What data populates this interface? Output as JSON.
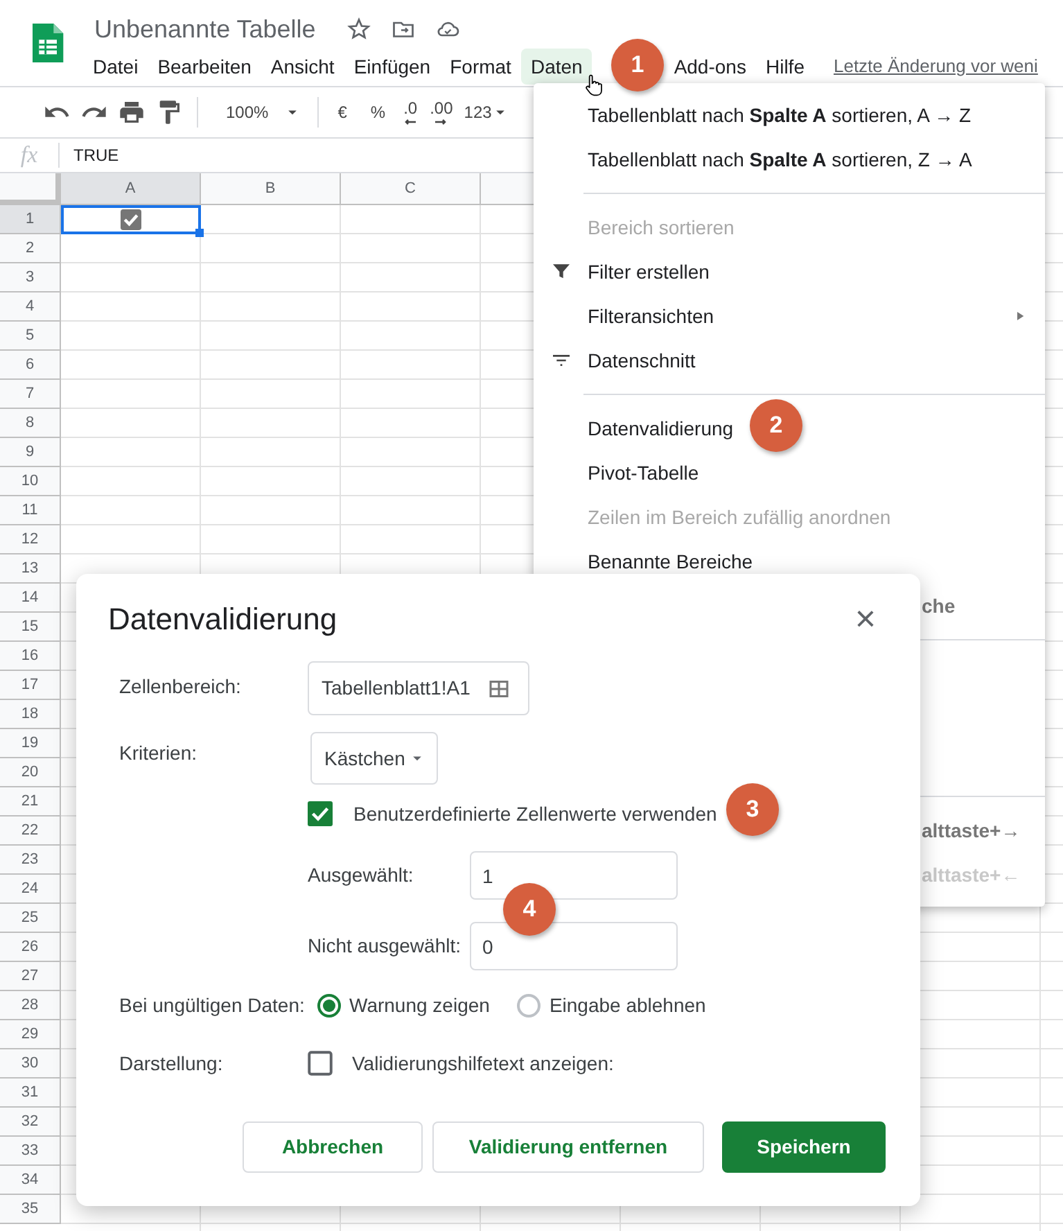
{
  "document": {
    "title": "Unbenannte Tabelle"
  },
  "menu_bar": [
    {
      "label": "Datei",
      "selected": false
    },
    {
      "label": "Bearbeiten",
      "selected": false
    },
    {
      "label": "Ansicht",
      "selected": false
    },
    {
      "label": "Einfügen",
      "selected": false
    },
    {
      "label": "Format",
      "selected": false
    },
    {
      "label": "Daten",
      "selected": true
    },
    {
      "label": "Add-ons",
      "selected": false
    },
    {
      "label": "Hilfe",
      "selected": false
    }
  ],
  "last_edit_link": "Letzte Änderung vor weni",
  "toolbar": {
    "zoom": "100%",
    "currency": "€",
    "percent": "%",
    "decrease_decimals": ".0",
    "increase_decimals": ".00",
    "number_format": "123"
  },
  "formula_bar": {
    "fx": "fx",
    "value": "TRUE"
  },
  "grid": {
    "columns": [
      {
        "label": "A",
        "selected": true
      },
      {
        "label": "B",
        "selected": false
      },
      {
        "label": "C",
        "selected": false
      }
    ],
    "rows": [
      {
        "label": "1",
        "selected": true
      },
      {
        "label": "2",
        "selected": false
      },
      {
        "label": "3",
        "selected": false
      },
      {
        "label": "4",
        "selected": false
      },
      {
        "label": "5",
        "selected": false
      },
      {
        "label": "6",
        "selected": false
      },
      {
        "label": "7",
        "selected": false
      },
      {
        "label": "8",
        "selected": false
      },
      {
        "label": "9",
        "selected": false
      },
      {
        "label": "10",
        "selected": false
      },
      {
        "label": "11",
        "selected": false
      },
      {
        "label": "12",
        "selected": false
      },
      {
        "label": "13",
        "selected": false
      },
      {
        "label": "14",
        "selected": false
      },
      {
        "label": "15",
        "selected": false
      },
      {
        "label": "16",
        "selected": false
      },
      {
        "label": "17",
        "selected": false
      },
      {
        "label": "18",
        "selected": false
      },
      {
        "label": "19",
        "selected": false
      },
      {
        "label": "20",
        "selected": false
      },
      {
        "label": "21",
        "selected": false
      },
      {
        "label": "22",
        "selected": false
      },
      {
        "label": "23",
        "selected": false
      },
      {
        "label": "24",
        "selected": false
      },
      {
        "label": "25",
        "selected": false
      },
      {
        "label": "26",
        "selected": false
      },
      {
        "label": "27",
        "selected": false
      },
      {
        "label": "28",
        "selected": false
      },
      {
        "label": "29",
        "selected": false
      },
      {
        "label": "30",
        "selected": false
      },
      {
        "label": "31",
        "selected": false
      },
      {
        "label": "32",
        "selected": false
      },
      {
        "label": "33",
        "selected": false
      },
      {
        "label": "34",
        "selected": false
      },
      {
        "label": "35",
        "selected": false
      }
    ],
    "cell_a1": {
      "kind": "checkbox",
      "checked": true,
      "selected": true
    }
  },
  "data_menu": [
    {
      "kind": "item",
      "label": "Tabellenblatt nach **Spalte A** sortieren, A → Z",
      "disabled": false
    },
    {
      "kind": "item",
      "label": "Tabellenblatt nach **Spalte A** sortieren, Z → A",
      "disabled": false
    },
    {
      "kind": "divider"
    },
    {
      "kind": "item",
      "label": "Bereich sortieren",
      "disabled": true
    },
    {
      "kind": "filter",
      "label": "Filter erstellen",
      "disabled": false
    },
    {
      "kind": "submenu",
      "label": "Filteransichten",
      "disabled": false
    },
    {
      "kind": "slicer",
      "label": "Datenschnitt",
      "disabled": false
    },
    {
      "kind": "divider"
    },
    {
      "kind": "item",
      "label": "Datenvalidierung",
      "disabled": false
    },
    {
      "kind": "item",
      "label": "Pivot-Tabelle",
      "disabled": false
    },
    {
      "kind": "item",
      "label": "Zeilen im Bereich zufällig anordnen",
      "disabled": true
    },
    {
      "kind": "item",
      "label": "Benannte Bereiche",
      "disabled": false
    },
    {
      "kind": "partial",
      "label": "che",
      "disabled": false
    },
    {
      "kind": "divider"
    },
    {
      "kind": "hidden"
    },
    {
      "kind": "hidden"
    },
    {
      "kind": "hidden"
    },
    {
      "kind": "divider"
    },
    {
      "kind": "partial",
      "label": "alttaste+→",
      "disabled": false
    },
    {
      "kind": "partial",
      "label": "alttaste+←",
      "disabled": true
    }
  ],
  "dialog": {
    "title": "Datenvalidierung",
    "close": "×",
    "cell_range": {
      "label": "Zellenbereich:",
      "value": "Tabellenblatt1!A1"
    },
    "criteria": {
      "label": "Kriterien:",
      "value": "Kästchen"
    },
    "custom_values": {
      "label": "Benutzerdefinierte Zellenwerte verwenden",
      "checked": true
    },
    "checked_value": {
      "label": "Ausgewählt:",
      "value": "1"
    },
    "unchecked_value": {
      "label": "Nicht ausgewählt:",
      "value": "0"
    },
    "invalid_data": {
      "label": "Bei ungültigen Daten:",
      "options": [
        {
          "label": "Warnung zeigen",
          "selected": true
        },
        {
          "label": "Eingabe ablehnen",
          "selected": false
        }
      ]
    },
    "appearance": {
      "label": "Darstellung:",
      "option": {
        "label": "Validierungshilfetext anzeigen:",
        "checked": false
      }
    },
    "buttons": [
      {
        "label": "Abbrechen",
        "kind": "secondary"
      },
      {
        "label": "Validierung entfernen",
        "kind": "secondary"
      },
      {
        "label": "Speichern",
        "kind": "primary"
      }
    ]
  },
  "badges": [
    {
      "number": "1"
    },
    {
      "number": "2"
    },
    {
      "number": "3"
    },
    {
      "number": "4"
    }
  ]
}
